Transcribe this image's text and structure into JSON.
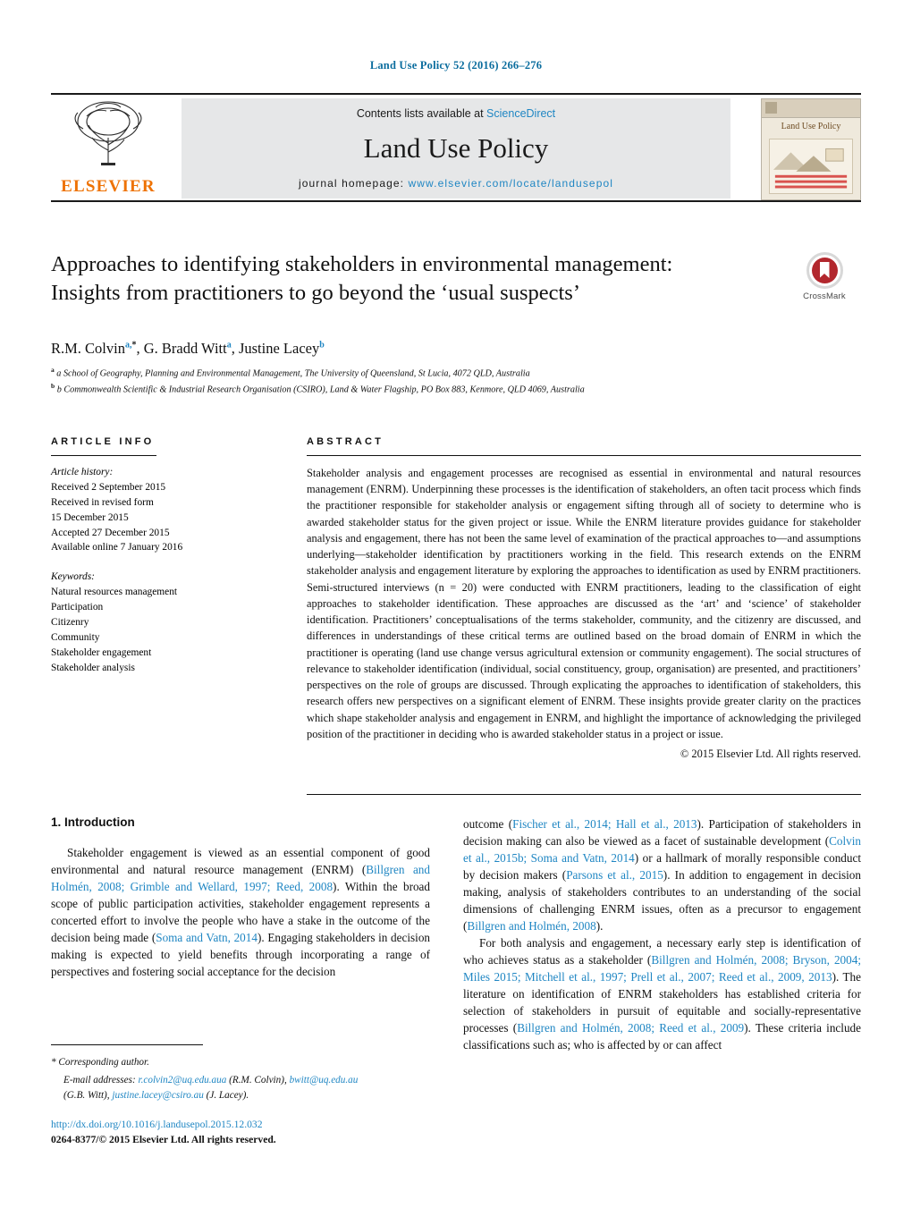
{
  "running_head": "Land Use Policy 52 (2016) 266–276",
  "masthead": {
    "publisher_name": "ELSEVIER",
    "contents_prefix": "Contents lists available at ",
    "contents_link": "ScienceDirect",
    "journal_title": "Land Use Policy",
    "homepage_prefix": "journal homepage: ",
    "homepage_url": "www.elsevier.com/locate/landusepol",
    "cover_title": "Land Use Policy"
  },
  "article": {
    "title": "Approaches to identifying stakeholders in environmental management: Insights from practitioners to go beyond the ‘usual suspects’",
    "crossmark_label": "CrossMark",
    "authors_html": "R.M. Colvin<sup>a,</sup><sup class=\"plain\">*</sup>, G. Bradd Witt<sup>a</sup>, Justine Lacey<sup>b</sup>",
    "authors_plain": "R.M. Colvin a,*, G. Bradd Witt a, Justine Lacey b",
    "affiliations": [
      "a School of Geography, Planning and Environmental Management, The University of Queensland, St Lucia, 4072 QLD, Australia",
      "b Commonwealth Scientific & Industrial Research Organisation (CSIRO), Land & Water Flagship, PO Box 883, Kenmore, QLD 4069, Australia"
    ]
  },
  "article_info": {
    "heading": "ARTICLE INFO",
    "history_label": "Article history:",
    "history_lines": [
      "Received 2 September 2015",
      "Received in revised form",
      "15 December 2015",
      "Accepted 27 December 2015",
      "Available online 7 January 2016"
    ],
    "keywords_label": "Keywords:",
    "keywords": [
      "Natural resources management",
      "Participation",
      "Citizenry",
      "Community",
      "Stakeholder engagement",
      "Stakeholder analysis"
    ]
  },
  "abstract": {
    "heading": "ABSTRACT",
    "text": "Stakeholder analysis and engagement processes are recognised as essential in environmental and natural resources management (ENRM). Underpinning these processes is the identification of stakeholders, an often tacit process which finds the practitioner responsible for stakeholder analysis or engagement sifting through all of society to determine who is awarded stakeholder status for the given project or issue. While the ENRM literature provides guidance for stakeholder analysis and engagement, there has not been the same level of examination of the practical approaches to—and assumptions underlying—stakeholder identification by practitioners working in the field. This research extends on the ENRM stakeholder analysis and engagement literature by exploring the approaches to identification as used by ENRM practitioners. Semi-structured interviews (n = 20) were conducted with ENRM practitioners, leading to the classification of eight approaches to stakeholder identification. These approaches are discussed as the ‘art’ and ‘science’ of stakeholder identification. Practitioners’ conceptualisations of the terms stakeholder, community, and the citizenry are discussed, and differences in understandings of these critical terms are outlined based on the broad domain of ENRM in which the practitioner is operating (land use change versus agricultural extension or community engagement). The social structures of relevance to stakeholder identification (individual, social constituency, group, organisation) are presented, and practitioners’ perspectives on the role of groups are discussed. Through explicating the approaches to identification of stakeholders, this research offers new perspectives on a significant element of ENRM. These insights provide greater clarity on the practices which shape stakeholder analysis and engagement in ENRM, and highlight the importance of acknowledging the privileged position of the practitioner in deciding who is awarded stakeholder status in a project or issue.",
    "copyright": "© 2015 Elsevier Ltd. All rights reserved."
  },
  "introduction": {
    "section_number_title": "1. Introduction",
    "left_paragraphs": [
      {
        "segments": [
          {
            "t": "Stakeholder engagement is viewed as an essential component of good environmental and natural resource management (ENRM) (",
            "ref": false
          },
          {
            "t": "Billgren and Holmén, 2008; Grimble and Wellard, 1997; Reed, 2008",
            "ref": true
          },
          {
            "t": "). Within the broad scope of public participation activities, stakeholder engagement represents a concerted effort to involve the people who have a stake in the outcome of the decision being made (",
            "ref": false
          },
          {
            "t": "Soma and Vatn, 2014",
            "ref": true
          },
          {
            "t": "). Engaging stakeholders in decision making is expected to yield benefits through incorporating a range of perspectives and fostering social acceptance for the decision",
            "ref": false
          }
        ]
      }
    ],
    "right_paragraphs": [
      {
        "indent": false,
        "segments": [
          {
            "t": "outcome (",
            "ref": false
          },
          {
            "t": "Fischer et al., 2014; Hall et al., 2013",
            "ref": true
          },
          {
            "t": "). Participation of stakeholders in decision making can also be viewed as a facet of sustainable development (",
            "ref": false
          },
          {
            "t": "Colvin et al., 2015b; Soma and Vatn, 2014",
            "ref": true
          },
          {
            "t": ") or a hallmark of morally responsible conduct by decision makers (",
            "ref": false
          },
          {
            "t": "Parsons et al., 2015",
            "ref": true
          },
          {
            "t": "). In addition to engagement in decision making, analysis of stakeholders contributes to an understanding of the social dimensions of challenging ENRM issues, often as a precursor to engagement (",
            "ref": false
          },
          {
            "t": "Billgren and Holmén, 2008",
            "ref": true
          },
          {
            "t": ").",
            "ref": false
          }
        ]
      },
      {
        "indent": true,
        "segments": [
          {
            "t": "For both analysis and engagement, a necessary early step is identification of who achieves status as a stakeholder (",
            "ref": false
          },
          {
            "t": "Billgren and Holmén, 2008; Bryson, 2004; Miles 2015; Mitchell et al., 1997; Prell et al., 2007; Reed et al., 2009, 2013",
            "ref": true
          },
          {
            "t": "). The literature on identification of ENRM stakeholders has established criteria for selection of stakeholders in pursuit of equitable and socially-representative processes (",
            "ref": false
          },
          {
            "t": "Billgren and Holmén, 2008; Reed et al., 2009",
            "ref": true
          },
          {
            "t": "). These criteria include classifications such as; who is affected by or can affect",
            "ref": false
          }
        ]
      }
    ]
  },
  "footnotes": {
    "corresponding_marker": "*",
    "corresponding_text": "Corresponding author.",
    "emails_label": "E-mail addresses:",
    "emails": [
      {
        "address": "r.colvin2@uq.edu.aua",
        "name": "(R.M. Colvin),"
      },
      {
        "address": "bwitt@uq.edu.au",
        "name": "(G.B. Witt),"
      },
      {
        "address": "justine.lacey@csiro.au",
        "name": "(J. Lacey)."
      }
    ]
  },
  "footer": {
    "doi": "http://dx.doi.org/10.1016/j.landusepol.2015.12.032",
    "issn_line": "0264-8377/© 2015 Elsevier Ltd. All rights reserved."
  },
  "colors": {
    "link_blue": "#1f86c3",
    "header_blue": "#0b6d9e",
    "elsevier_orange": "#ee7203",
    "masthead_gray": "#e6e7e8",
    "crossmark_red": "#b2272d"
  }
}
